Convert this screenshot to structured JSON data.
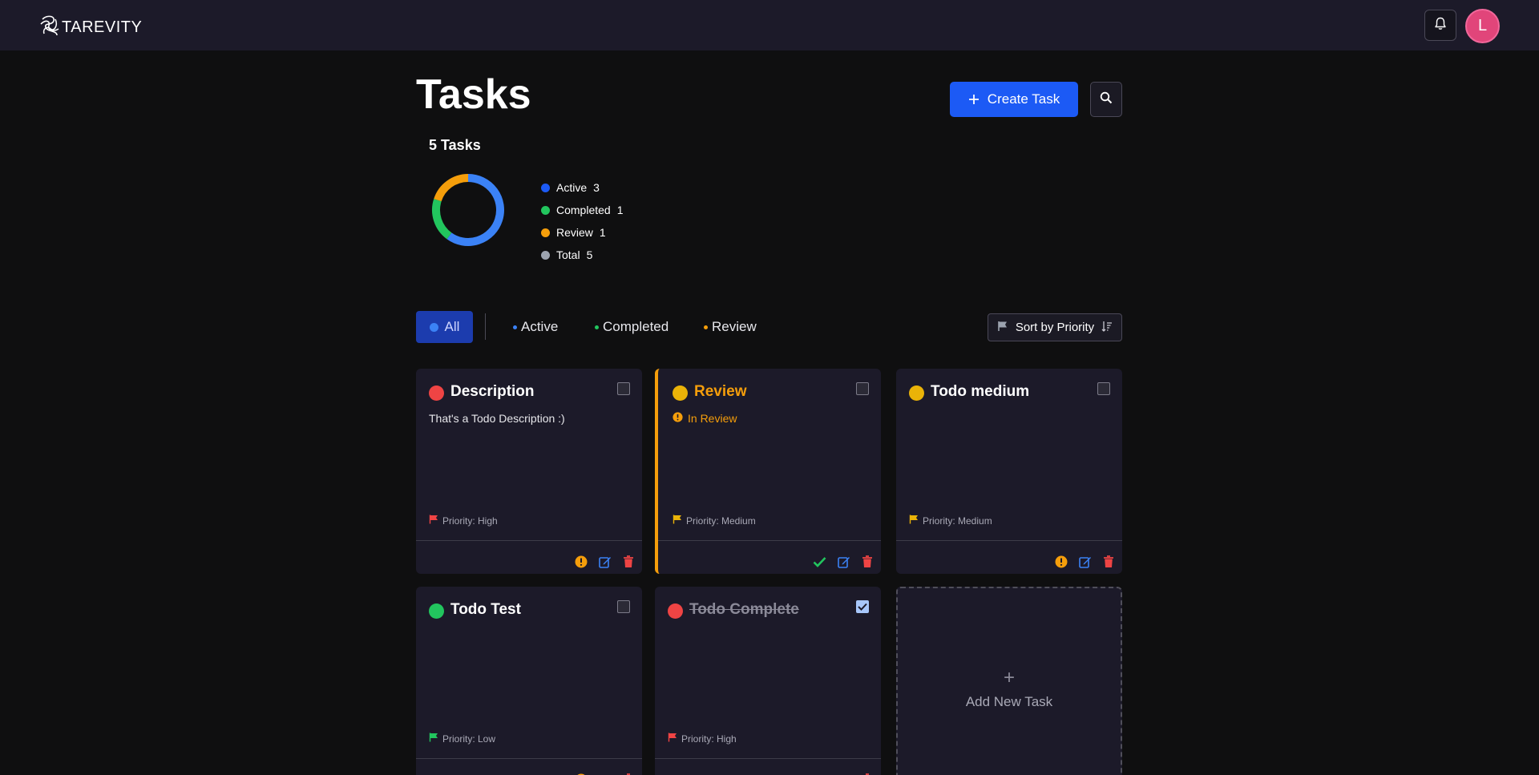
{
  "header": {
    "app_name": "TAREVITY",
    "avatar_initial": "L"
  },
  "page": {
    "title": "Tasks",
    "create_button": "Create Task"
  },
  "summary": {
    "tasks_count_label": "5 Tasks",
    "legend": [
      {
        "label": "Active",
        "count": "3",
        "color": "#1c5af5"
      },
      {
        "label": "Completed",
        "count": "1",
        "color": "#22c55e"
      },
      {
        "label": "Review",
        "count": "1",
        "color": "#f59e0b"
      },
      {
        "label": "Total",
        "count": "5",
        "color": "#9ca3af"
      }
    ],
    "donut": [
      {
        "name": "Active",
        "value": 3,
        "color": "#3b82f6"
      },
      {
        "name": "Completed",
        "value": 1,
        "color": "#22c55e"
      },
      {
        "name": "Review",
        "value": 1,
        "color": "#f59e0b"
      }
    ]
  },
  "filters": {
    "all": "All",
    "tabs": [
      {
        "label": "Active",
        "color": "#3b82f6"
      },
      {
        "label": "Completed",
        "color": "#22c55e"
      },
      {
        "label": "Review",
        "color": "#f59e0b"
      }
    ],
    "sort_label": "Sort by Priority"
  },
  "tasks": [
    {
      "title": "Description",
      "description": "That's a Todo Description :)",
      "priority": "Priority: High",
      "dot_color": "#ef4444",
      "flag_color": "#ef4444",
      "checked": false
    },
    {
      "title": "Review",
      "status": "In Review",
      "priority": "Priority: Medium",
      "dot_color": "#eab308",
      "flag_color": "#eab308",
      "checked": false
    },
    {
      "title": "Todo medium",
      "priority": "Priority: Medium",
      "dot_color": "#eab308",
      "flag_color": "#eab308",
      "checked": false
    },
    {
      "title": "Todo Test",
      "priority": "Priority: Low",
      "dot_color": "#22c55e",
      "flag_color": "#22c55e",
      "checked": false
    },
    {
      "title": "Todo Complete",
      "priority": "Priority: High",
      "dot_color": "#ef4444",
      "flag_color": "#ef4444",
      "checked": true
    }
  ],
  "add_card": {
    "plus": "+",
    "label": "Add New Task"
  },
  "colors": {
    "background": "#0f0f10",
    "surface": "#1c1a29",
    "accent": "#1c5af5",
    "review": "#f59e0b",
    "edit": "#3b82f6",
    "delete": "#ef4444",
    "complete": "#22c55e"
  }
}
